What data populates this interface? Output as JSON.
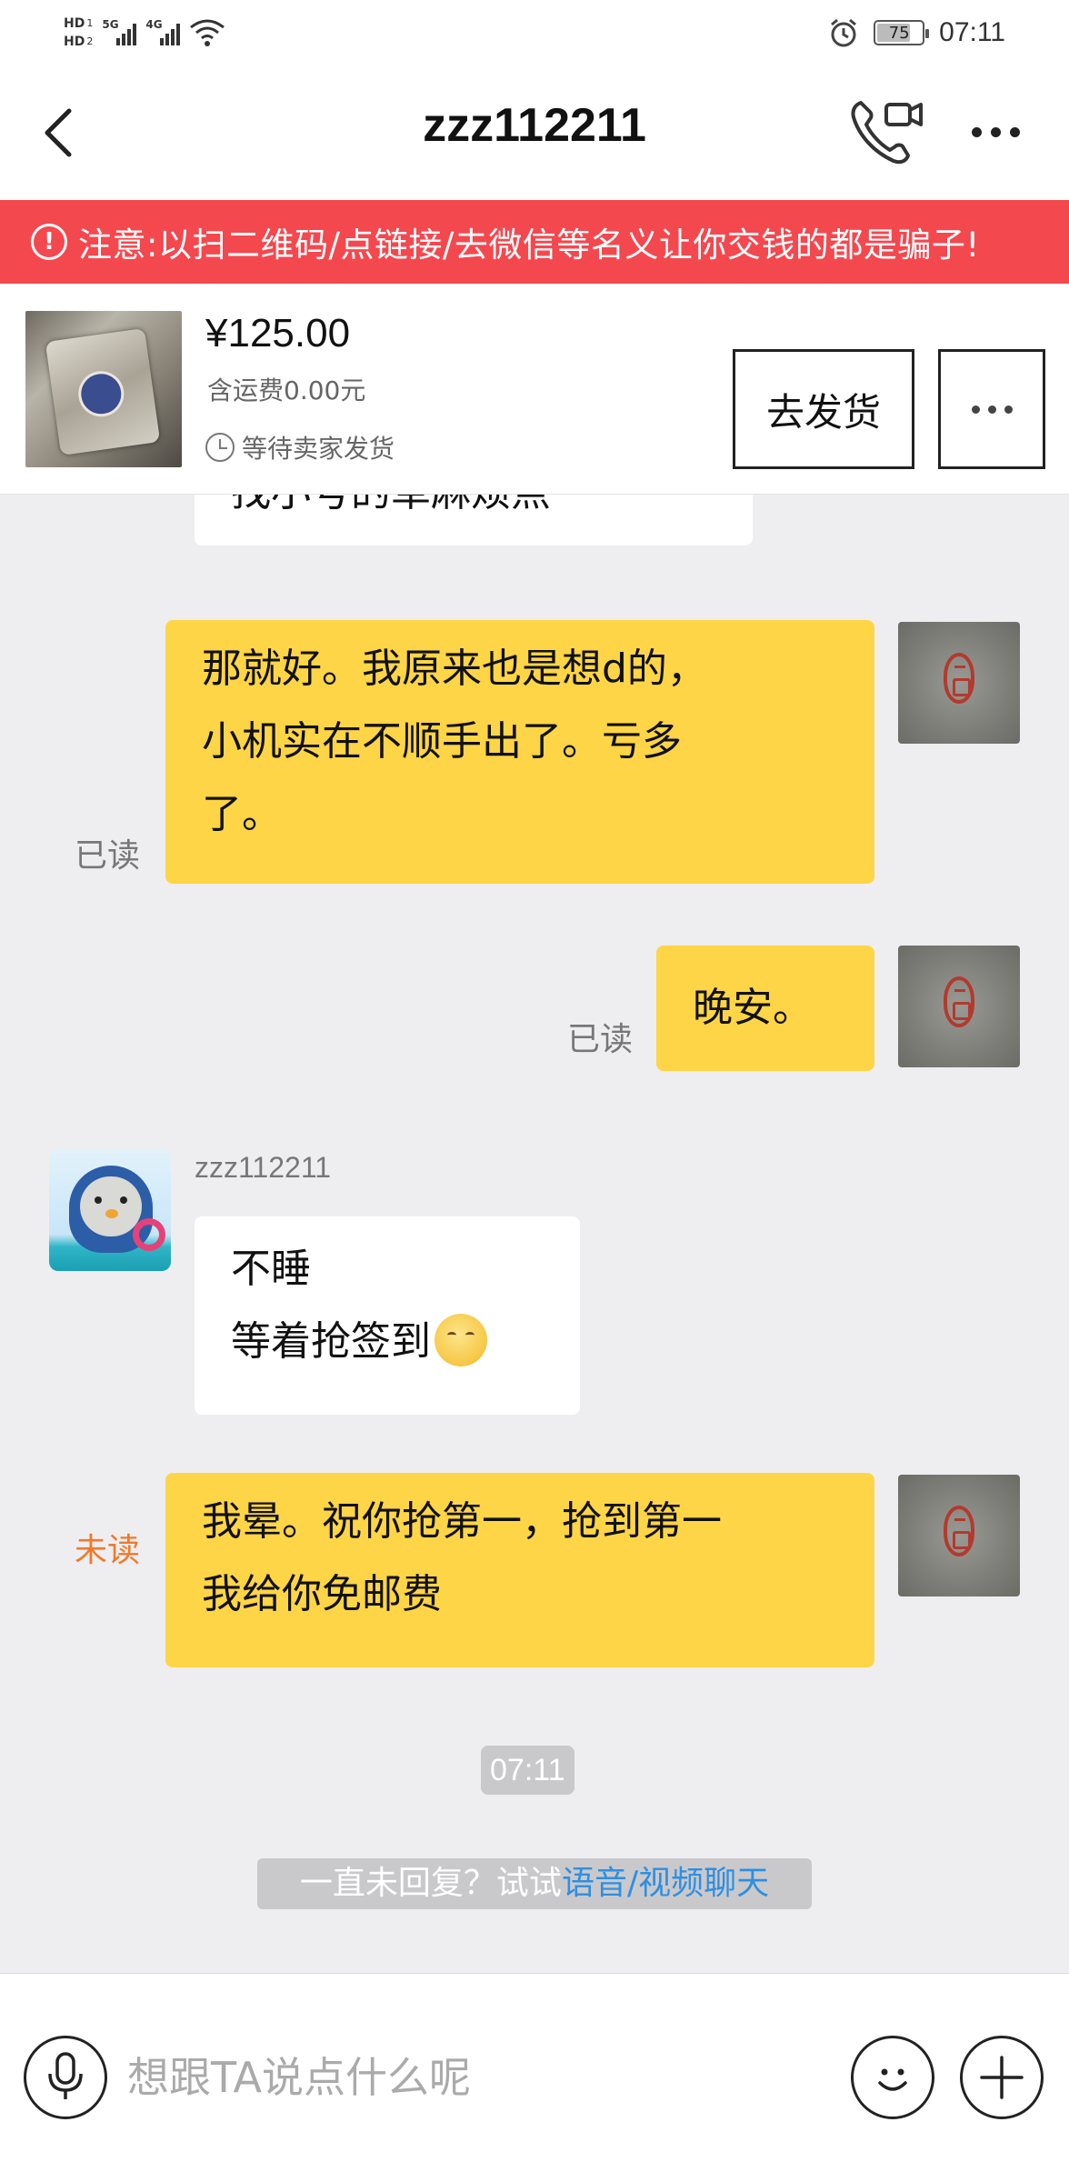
{
  "status_bar": {
    "hd1": "HD",
    "hd1_num": "1",
    "hd2": "HD",
    "hd2_num": "2",
    "network1": "5G",
    "network2": "4G",
    "battery": "75",
    "battery_level_percent": 75,
    "time": "07:11"
  },
  "header": {
    "title": "zzz112211"
  },
  "warning": {
    "icon": "!",
    "text": "注意:以扫二维码/点链接/去微信等名义让你交钱的都是骗子!"
  },
  "order": {
    "price": "¥125.00",
    "shipping": "含运费0.00元",
    "status": "等待卖家发货",
    "ship_button": "去发货"
  },
  "messages": [
    {
      "from": "them",
      "lines": [
        "找小号的草麻烦点"
      ]
    },
    {
      "from": "me",
      "lines": [
        "那就好。我原来也是想d的，",
        "小机实在不顺手出了。亏多",
        "了。"
      ],
      "receipt": "已读"
    },
    {
      "from": "me",
      "lines": [
        "晚安。"
      ],
      "receipt": "已读"
    },
    {
      "from": "them",
      "sender": "zzz112211",
      "lines": [
        "不睡",
        "等着抢签到"
      ]
    },
    {
      "from": "me",
      "lines": [
        "我晕。祝你抢第一，抢到第一",
        "我给你免邮费"
      ],
      "receipt": "未读"
    }
  ],
  "timestamp": "07:11",
  "hint": {
    "prefix": "一直未回复？试试",
    "link": "语音/视频聊天"
  },
  "input": {
    "placeholder": "想跟TA说点什么呢"
  },
  "colors": {
    "accent_yellow": "#fed546",
    "warning_red": "#f4484f",
    "unread_orange": "#f07a2a",
    "link_blue": "#2f8fe0"
  }
}
